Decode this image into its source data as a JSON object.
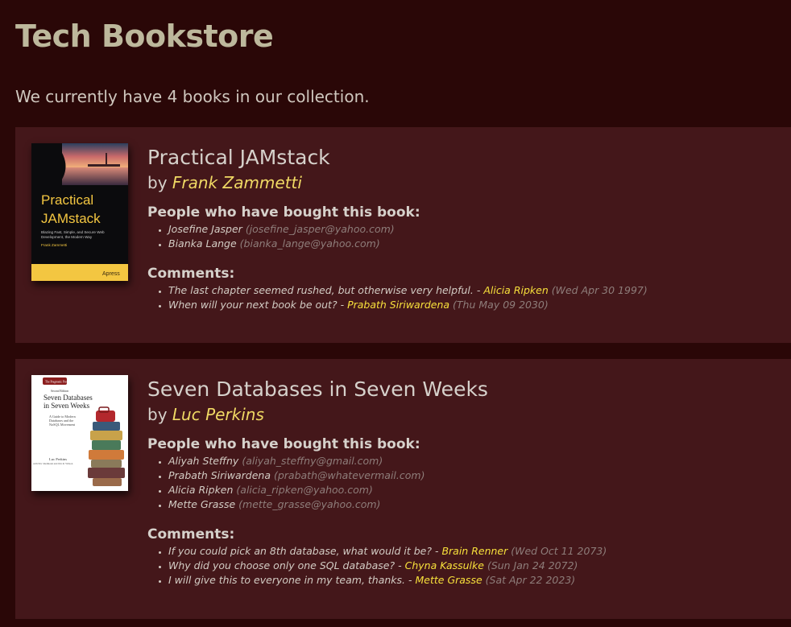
{
  "page": {
    "title": "Tech Bookstore",
    "summary": "We currently have 4 books in our collection."
  },
  "books": [
    {
      "title": "Practical JAMstack",
      "by": "by",
      "author": "Frank Zammetti",
      "cover": {
        "title_line1": "Practical",
        "title_line2": "JAMstack",
        "subtitle_line1": "Blazing Fast, Simple, and Secure Web",
        "subtitle_line2": "Development, the Modern Way",
        "author": "Frank Zammetti",
        "publisher": "Apress"
      },
      "buyers_heading": "People who have bought this book:",
      "buyers": [
        {
          "name": "Josefine Jasper",
          "email": "(josefine_jasper@yahoo.com)"
        },
        {
          "name": "Bianka Lange",
          "email": "(bianka_lange@yahoo.com)"
        }
      ],
      "comments_heading": "Comments:",
      "comments": [
        {
          "text": "The last chapter seemed rushed, but otherwise very helpful. -",
          "user": "Alicia Ripken",
          "date": "(Wed Apr 30 1997)"
        },
        {
          "text": "When will your next book be out? -",
          "user": "Prabath Siriwardena",
          "date": "(Thu May 09 2030)"
        }
      ]
    },
    {
      "title": "Seven Databases in Seven Weeks",
      "by": "by",
      "author": "Luc Perkins",
      "cover": {
        "series": "The Pragmatic Programmers",
        "edition": "Second Edition",
        "title_line1": "Seven Databases",
        "title_line2": "in Seven Weeks",
        "subtitle_line1": "A Guide to Modern",
        "subtitle_line2": "Databases and the",
        "subtitle_line3": "NoSQL Movement",
        "author": "Luc Perkins",
        "coauthors": "with Eric Redmond and Jim R. Wilson"
      },
      "buyers_heading": "People who have bought this book:",
      "buyers": [
        {
          "name": "Aliyah Steffny",
          "email": "(aliyah_steffny@gmail.com)"
        },
        {
          "name": "Prabath Siriwardena",
          "email": "(prabath@whatevermail.com)"
        },
        {
          "name": "Alicia Ripken",
          "email": "(alicia_ripken@yahoo.com)"
        },
        {
          "name": "Mette Grasse",
          "email": "(mette_grasse@yahoo.com)"
        }
      ],
      "comments_heading": "Comments:",
      "comments": [
        {
          "text": "If you could pick an 8th database, what would it be? -",
          "user": "Brain Renner",
          "date": "(Wed Oct 11 2073)"
        },
        {
          "text": "Why did you choose only one SQL database? -",
          "user": "Chyna Kassulke",
          "date": "(Sun Jan 24 2072)"
        },
        {
          "text": "I will give this to everyone in my team, thanks. -",
          "user": "Mette Grasse",
          "date": "(Sat Apr 22 2023)"
        }
      ]
    }
  ],
  "colors": {
    "background": "#2a0707",
    "card": "#44171a",
    "author": "#f0d964",
    "commenter": "#f7e03b",
    "muted": "#8e7d7a"
  }
}
